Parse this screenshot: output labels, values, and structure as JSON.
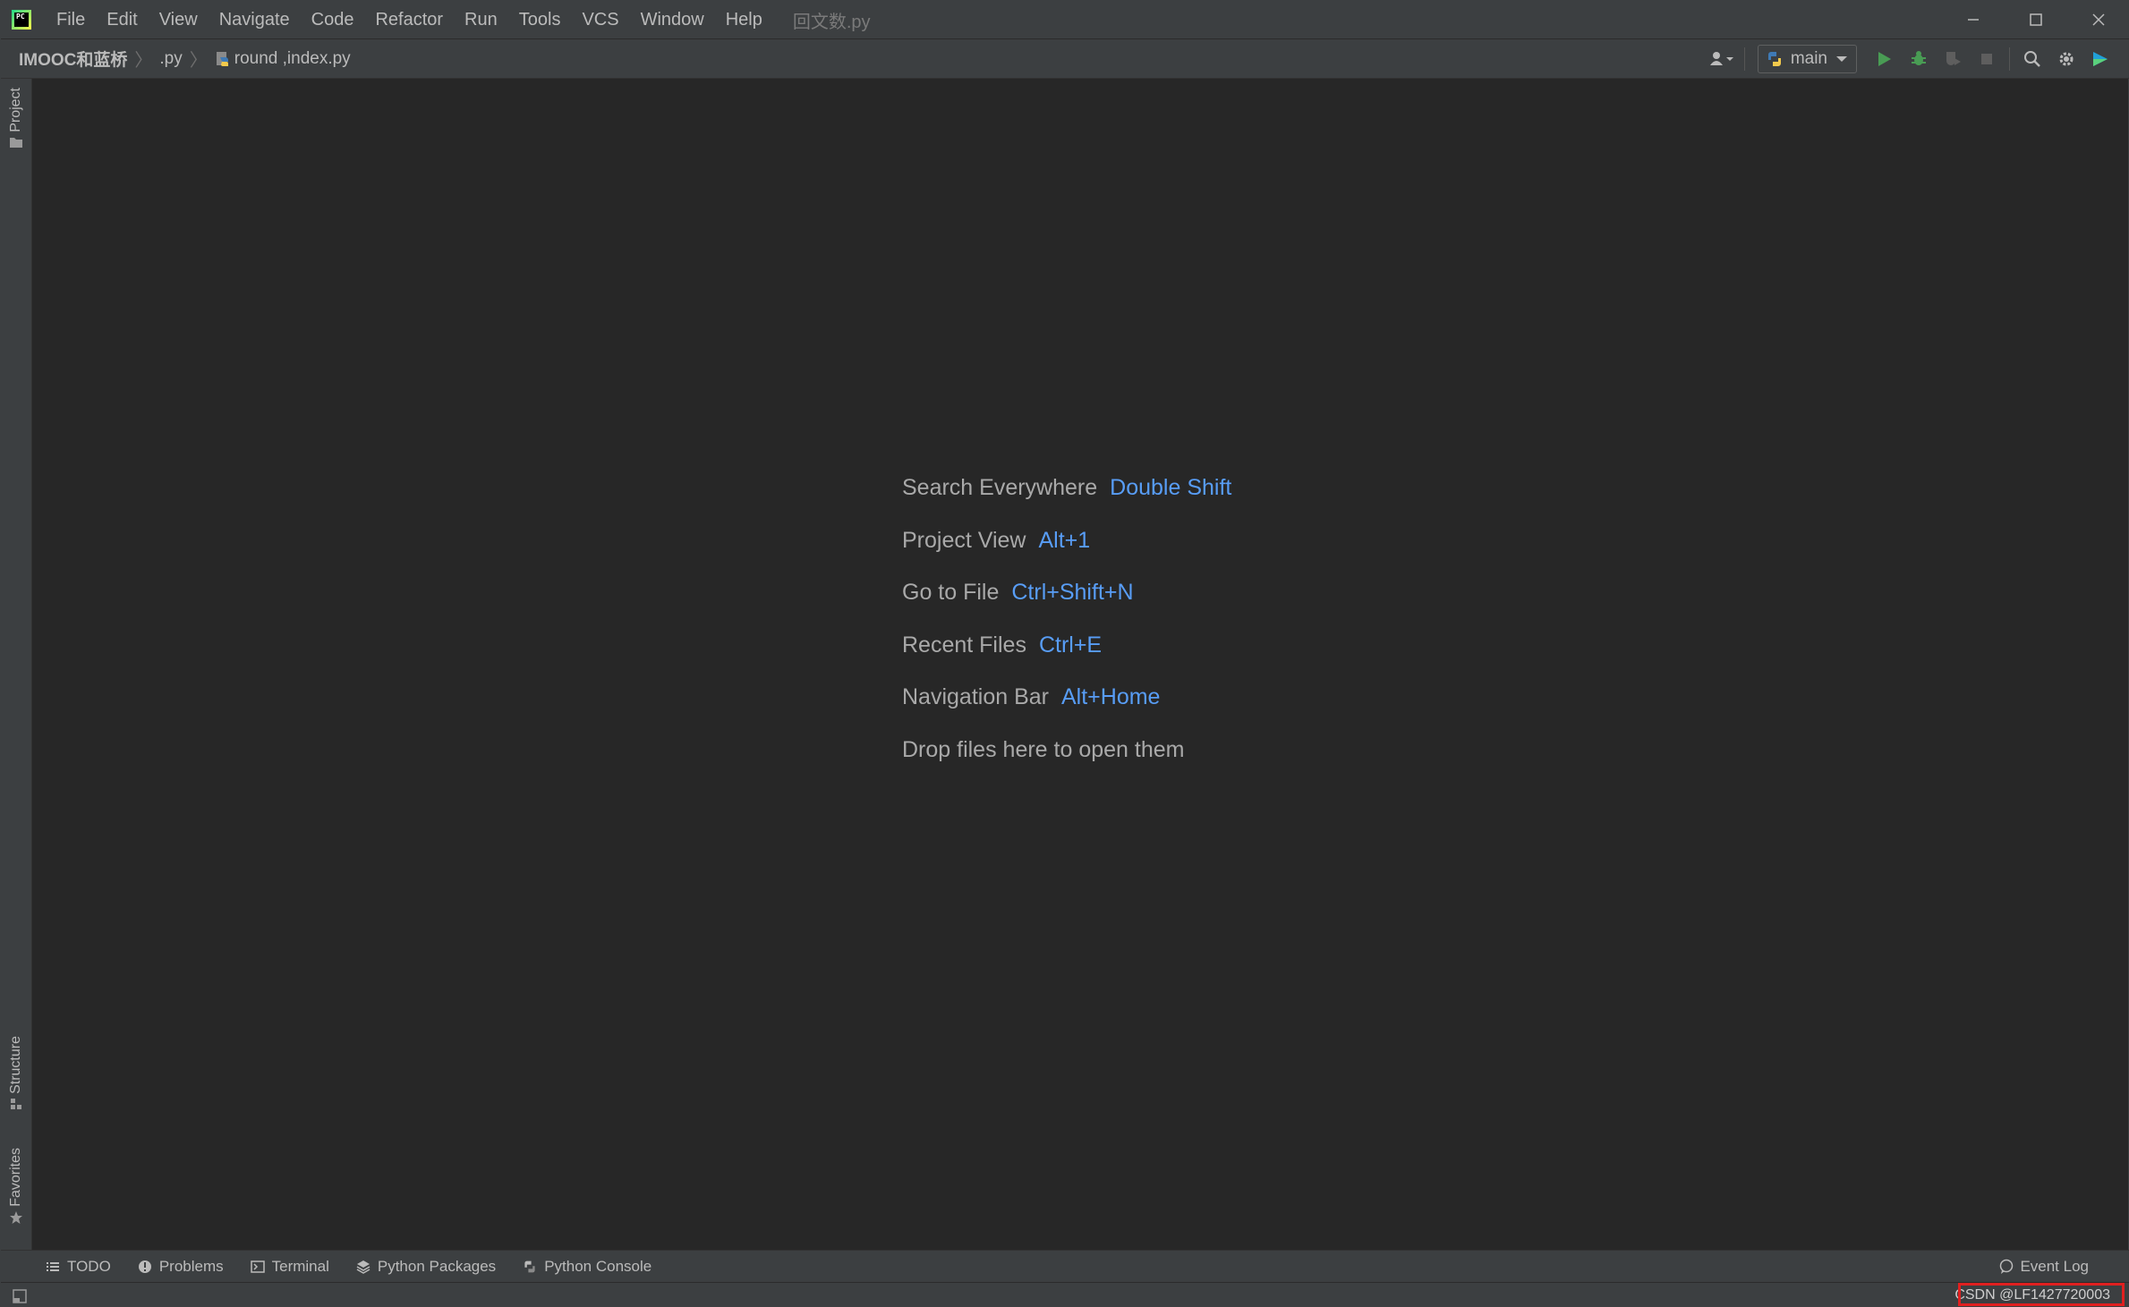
{
  "titlebar": {
    "logo_text": "PC",
    "menu": [
      "File",
      "Edit",
      "View",
      "Navigate",
      "Code",
      "Refactor",
      "Run",
      "Tools",
      "VCS",
      "Window",
      "Help"
    ],
    "file_title": "回文数.py"
  },
  "navbar": {
    "breadcrumbs": [
      "IMOOC和蓝桥",
      ".py",
      "round ,index.py"
    ],
    "run_config": "main"
  },
  "left_tools": {
    "project": "Project",
    "structure": "Structure",
    "favorites": "Favorites"
  },
  "hints": [
    {
      "action": "Search Everywhere",
      "shortcut": "Double Shift"
    },
    {
      "action": "Project View",
      "shortcut": "Alt+1"
    },
    {
      "action": "Go to File",
      "shortcut": "Ctrl+Shift+N"
    },
    {
      "action": "Recent Files",
      "shortcut": "Ctrl+E"
    },
    {
      "action": "Navigation Bar",
      "shortcut": "Alt+Home"
    },
    {
      "action": "Drop files here to open them",
      "shortcut": ""
    }
  ],
  "bottom_tools": {
    "todo": "TODO",
    "problems": "Problems",
    "terminal": "Terminal",
    "python_packages": "Python Packages",
    "python_console": "Python Console",
    "event_log": "Event Log"
  },
  "status": {
    "watermark": "CSDN @LF1427720003"
  },
  "colors": {
    "background": "#272727",
    "chrome": "#3c3f41",
    "shortcut": "#589df6",
    "run_green": "#499c54",
    "highlight_red": "#e02020"
  }
}
